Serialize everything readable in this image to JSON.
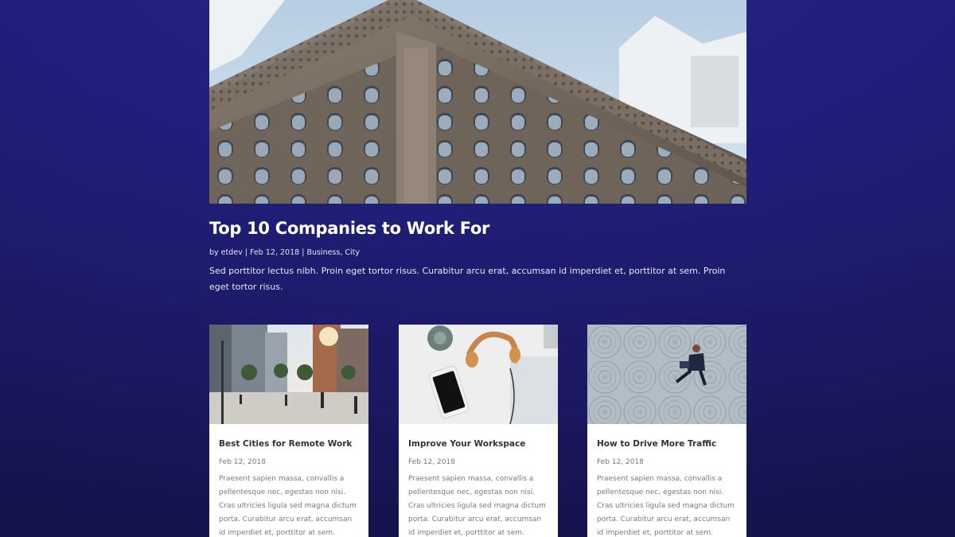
{
  "featured": {
    "title": "Top 10 Companies to Work For",
    "author": "by etdev",
    "date": "Feb 12, 2018",
    "categories": "Business, City",
    "separator": "|",
    "excerpt": "Sed porttitor lectus nibh. Proin eget tortor risus. Curabitur arcu erat, accumsan id imperdiet et, porttitor at sem. Proin eget tortor risus."
  },
  "cards": [
    {
      "title": "Best Cities for Remote Work",
      "date": "Feb 12, 2018",
      "excerpt": "Praesent sapien massa, convallis a pellentesque nec, egestas non nisi. Cras ultricies ligula sed magna dictum porta. Curabitur arcu erat, accumsan id imperdiet et, porttitor at sem."
    },
    {
      "title": "Improve Your Workspace",
      "date": "Feb 12, 2018",
      "excerpt": "Praesent sapien massa, convallis a pellentesque nec, egestas non nisi. Cras ultricies ligula sed magna dictum porta. Curabitur arcu erat, accumsan id imperdiet et, porttitor at sem."
    },
    {
      "title": "How to Drive More Traffic",
      "date": "Feb 12, 2018",
      "excerpt": "Praesent sapien massa, convallis a pellentesque nec, egestas non nisi. Cras ultricies ligula sed magna dictum porta. Curabitur arcu erat, accumsan id imperdiet et, porttitor at sem."
    }
  ],
  "colors": {
    "background": "#211f7c",
    "card_background": "#ffffff",
    "card_title": "#333333",
    "card_text": "#7a7a7a"
  }
}
